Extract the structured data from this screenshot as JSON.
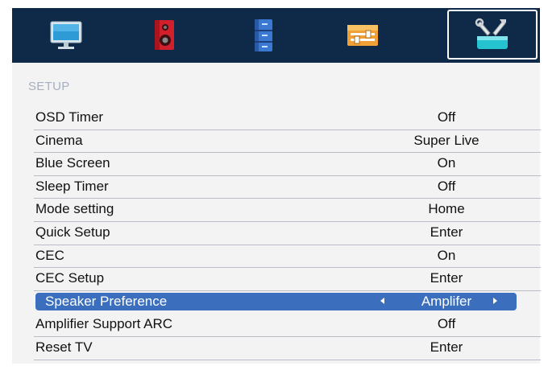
{
  "tabs": [
    {
      "icon": "tv-picture-icon"
    },
    {
      "icon": "speaker-sound-icon"
    },
    {
      "icon": "channel-cabinet-icon"
    },
    {
      "icon": "feature-slider-icon"
    },
    {
      "icon": "setup-tools-icon",
      "active": true
    }
  ],
  "section_title": "SETUP",
  "items": [
    {
      "label": "OSD Timer",
      "value": "Off"
    },
    {
      "label": "Cinema",
      "value": "Super Live"
    },
    {
      "label": "Blue Screen",
      "value": "On"
    },
    {
      "label": "Sleep Timer",
      "value": "Off"
    },
    {
      "label": "Mode setting",
      "value": "Home"
    },
    {
      "label": "Quick Setup",
      "value": "Enter"
    },
    {
      "label": "CEC",
      "value": "On"
    },
    {
      "label": "CEC Setup",
      "value": "Enter"
    },
    {
      "label": "Speaker Preference",
      "value": "Amplifer",
      "selected": true
    },
    {
      "label": "Amplifier Support ARC",
      "value": "Off"
    },
    {
      "label": "Reset TV",
      "value": "Enter"
    }
  ],
  "colors": {
    "tab_bar": "#0f2a48",
    "menu_bg": "#f3f3f4",
    "selection": "#3b6fbd",
    "section_title": "#a6afbf"
  }
}
